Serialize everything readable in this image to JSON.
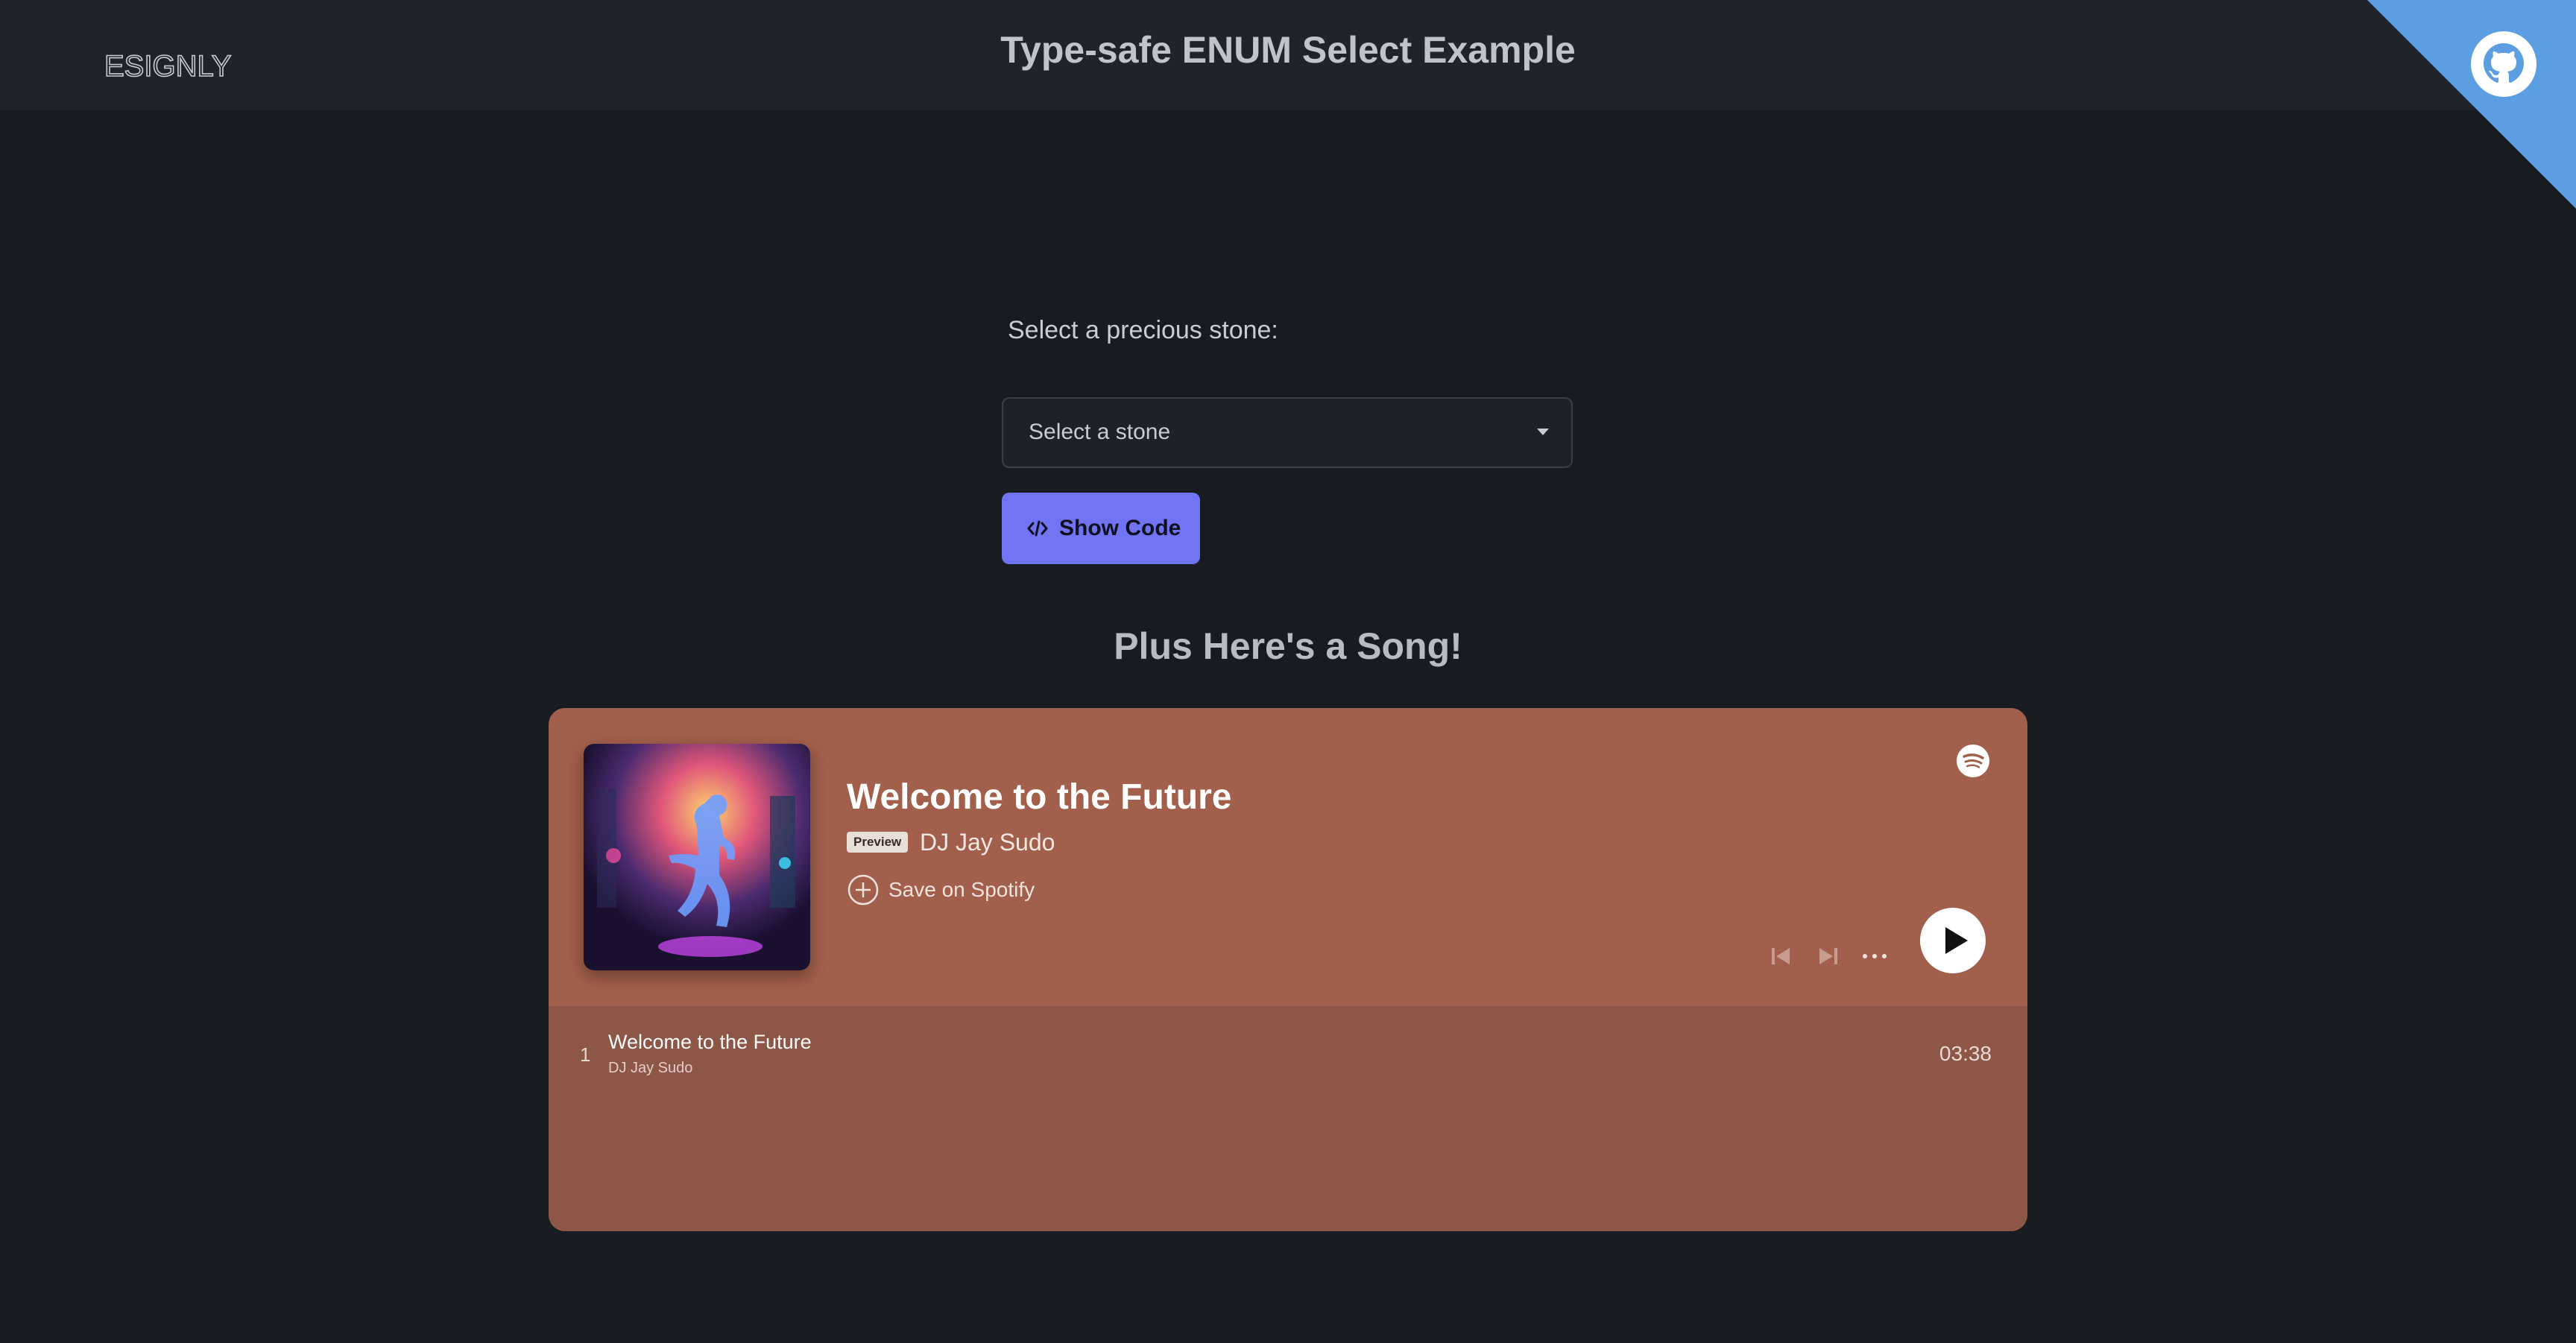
{
  "header": {
    "logo_text": "ESIGNLY",
    "title": "Type-safe ENUM Select Example",
    "github_icon": "github-icon"
  },
  "form": {
    "label": "Select a precious stone:",
    "select_placeholder": "Select a stone",
    "show_code_label": "Show Code",
    "show_code_icon": "code-icon"
  },
  "song_heading": "Plus Here's a Song!",
  "player": {
    "track_title": "Welcome to the Future",
    "preview_badge": "Preview",
    "artist": "DJ Jay Sudo",
    "save_label": "Save on Spotify",
    "colors": {
      "card": "#a25f4b",
      "card_bottom": "#8e5646",
      "accent_button": "#7174f2"
    },
    "tracks": [
      {
        "number": "1",
        "title": "Welcome to the Future",
        "artist": "DJ Jay Sudo",
        "duration": "03:38"
      }
    ]
  }
}
